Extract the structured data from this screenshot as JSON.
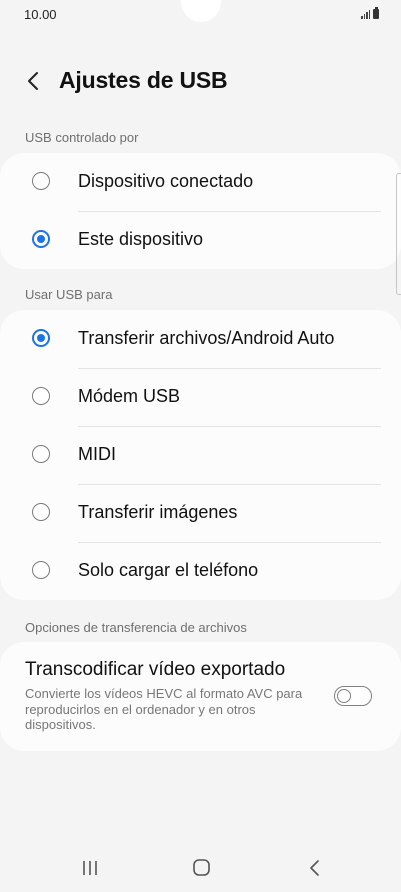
{
  "status_bar": {
    "time": "10.00"
  },
  "header": {
    "title": "Ajustes de USB"
  },
  "usb_controlled_by": {
    "label": "USB controlado por",
    "options": [
      {
        "label": "Dispositivo conectado",
        "selected": false
      },
      {
        "label": "Este dispositivo",
        "selected": true
      }
    ]
  },
  "use_usb_for": {
    "label": "Usar USB para",
    "options": [
      {
        "label": "Transferir archivos/Android Auto",
        "selected": true
      },
      {
        "label": "Módem USB",
        "selected": false
      },
      {
        "label": "MIDI",
        "selected": false
      },
      {
        "label": "Transferir imágenes",
        "selected": false
      },
      {
        "label": "Solo cargar el teléfono",
        "selected": false
      }
    ]
  },
  "file_transfer_options": {
    "label": "Opciones de transferencia de archivos",
    "transcode": {
      "title": "Transcodificar vídeo exportado",
      "description": "Convierte los vídeos HEVC al formato AVC para reproducirlos en el ordenador y en otros dispositivos.",
      "enabled": false
    }
  },
  "colors": {
    "accent": "#1a73e8",
    "background": "#f4f4f4",
    "card": "#fcfcfc"
  },
  "icons": [
    "back-arrow-icon",
    "signal-icon",
    "battery-icon",
    "recent-apps-icon",
    "home-icon",
    "nav-back-icon"
  ]
}
